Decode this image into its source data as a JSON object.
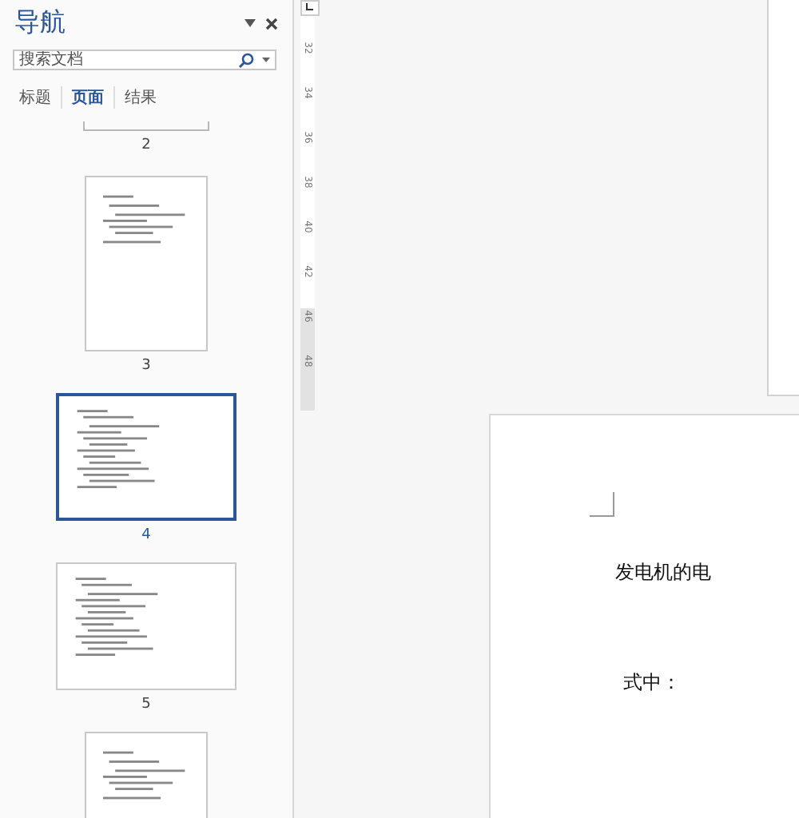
{
  "navigation": {
    "title": "导航",
    "search": {
      "placeholder": "搜索文档"
    },
    "tabs": [
      {
        "label": "标题",
        "selected": false
      },
      {
        "label": "页面",
        "selected": true
      },
      {
        "label": "结果",
        "selected": false
      }
    ],
    "pages": [
      {
        "number": "2",
        "kind": "tail",
        "selected": false
      },
      {
        "number": "3",
        "kind": "portrait",
        "selected": false
      },
      {
        "number": "4",
        "kind": "landscape",
        "selected": true
      },
      {
        "number": "5",
        "kind": "landscape",
        "selected": false
      },
      {
        "kind": "portrait",
        "selected": false
      }
    ]
  },
  "ruler": {
    "labels": [
      "32",
      "34",
      "36",
      "38",
      "40",
      "42",
      "46",
      "48"
    ]
  },
  "document": {
    "lines": [
      "发电机的电",
      "式中："
    ]
  }
}
